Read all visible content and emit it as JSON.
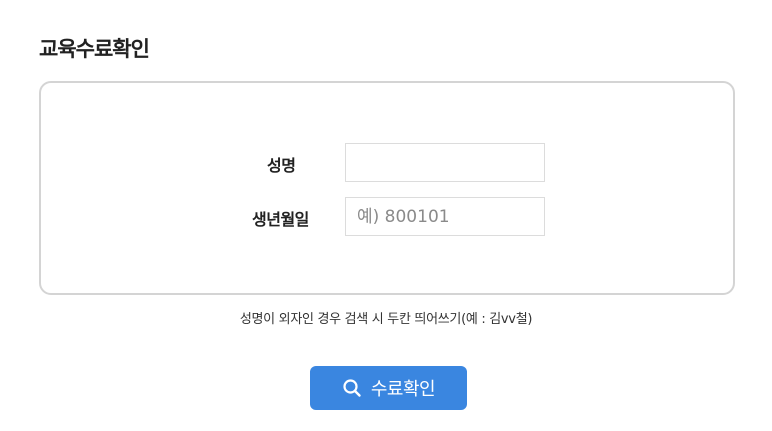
{
  "page": {
    "title": "교육수료확인"
  },
  "form": {
    "name_label": "성명",
    "name_value": "",
    "birth_label": "생년월일",
    "birth_placeholder": "예) 800101",
    "birth_value": ""
  },
  "notice": "성명이 외자인 경우 검색 시 두칸 띄어쓰기(예 : 김vv철)",
  "submit": {
    "label": "수료확인",
    "icon": "search-icon",
    "color": "#3a86e0"
  }
}
